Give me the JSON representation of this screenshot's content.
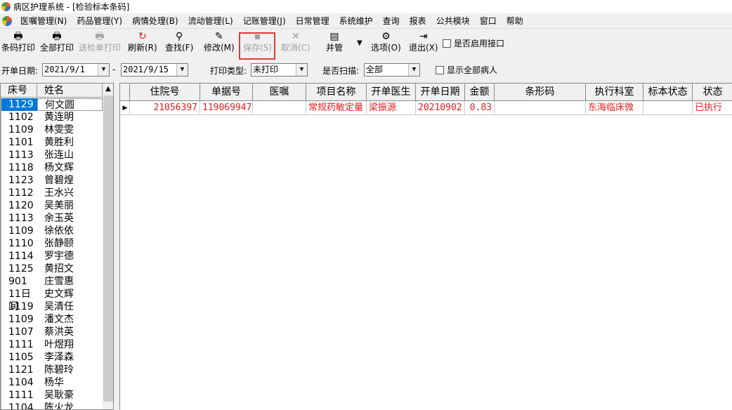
{
  "window": {
    "title": "病区护理系统 - [检验标本条码]"
  },
  "menu": [
    "医嘱管理(N)",
    "药品管理(Y)",
    "病情处理(B)",
    "流动管理(L)",
    "记账管理(J)",
    "日常管理",
    "系统维护",
    "查询",
    "报表",
    "公共模块",
    "窗口",
    "帮助"
  ],
  "toolbar": {
    "barcode_print": "条码打印",
    "print_all": "全部打印",
    "send_print": "送检单打印",
    "refresh": "刷新(R)",
    "find": "查找(F)",
    "modify": "修改(M)",
    "save": "保存(S)",
    "cancel": "取消(C)",
    "bingguan": "并管",
    "options": "选项(O)",
    "exit": "退出(X)",
    "enable_interface": "是否启用接口"
  },
  "filter": {
    "date_label": "开单日期:",
    "date_from": "2021/9/1",
    "date_sep": "-",
    "date_to": "2021/9/15",
    "print_type_label": "打印类型:",
    "print_type_value": "未打印",
    "scan_label": "是否扫描:",
    "scan_value": "全部",
    "show_all_label": "显示全部病人"
  },
  "patients": {
    "headers": [
      "床号",
      "姓名"
    ],
    "rows": [
      [
        "1129",
        "何文圆"
      ],
      [
        "1102",
        "黄连明"
      ],
      [
        "1109",
        "林雯雯"
      ],
      [
        "1101",
        "黄胜利"
      ],
      [
        "1113",
        "张连山"
      ],
      [
        "1118",
        "杨文辉"
      ],
      [
        "1123",
        "曾碧煌"
      ],
      [
        "1112",
        "王水兴"
      ],
      [
        "1120",
        "吴美丽"
      ],
      [
        "1113",
        "余玉英"
      ],
      [
        "1109",
        "徐依依"
      ],
      [
        "1110",
        "张静颐"
      ],
      [
        "1114",
        "罗宇德"
      ],
      [
        "1125",
        "黄招文"
      ],
      [
        "901",
        "庄雪惠"
      ],
      [
        "11日间",
        "史文辉"
      ],
      [
        "1119",
        "吴清任"
      ],
      [
        "1109",
        "潘文杰"
      ],
      [
        "1107",
        "蔡洪英"
      ],
      [
        "1111",
        "叶煜翔"
      ],
      [
        "1105",
        "李泽森"
      ],
      [
        "1121",
        "陈碧玲"
      ],
      [
        "1104",
        "杨华"
      ],
      [
        "1111",
        "吴耿豪"
      ],
      [
        "1104",
        "陈火龙"
      ]
    ]
  },
  "grid": {
    "headers": [
      "住院号",
      "单据号",
      "医嘱",
      "项目名称",
      "开单医生",
      "开单日期",
      "金额",
      "条形码",
      "执行科室",
      "标本状态",
      "状态"
    ],
    "rows": [
      [
        "21056397",
        "119069947",
        "",
        "常规药敏定量",
        "梁振源",
        "20210902",
        "0.83",
        "",
        "东海临床微",
        "",
        "已执行"
      ]
    ]
  },
  "colors": {
    "selection": "#0078d7",
    "row_text": "#e02020",
    "highlight_box": "#e03a3a"
  }
}
